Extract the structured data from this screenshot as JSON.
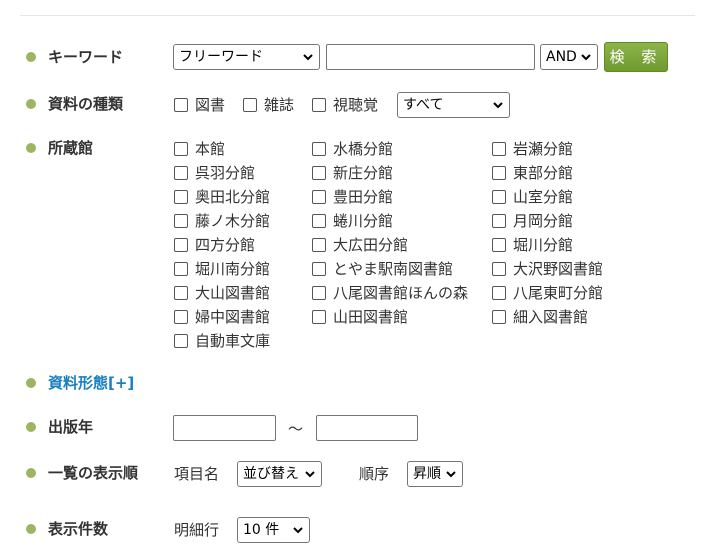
{
  "keyword": {
    "label": "キーワード",
    "field_select": "フリーワード",
    "text_value": "",
    "op_select": "AND",
    "search_button": "検 索"
  },
  "material_type": {
    "label": "資料の種類",
    "options": [
      "図書",
      "雑誌",
      "視聴覚"
    ],
    "select": "すべて"
  },
  "library": {
    "label": "所蔵館",
    "col1": [
      "本館",
      "呉羽分館",
      "奥田北分館",
      "藤ノ木分館",
      "四方分館",
      "堀川南分館",
      "大山図書館",
      "婦中図書館",
      "自動車文庫"
    ],
    "col2": [
      "水橋分館",
      "新庄分館",
      "豊田分館",
      "蜷川分館",
      "大広田分館",
      "とやま駅南図書館",
      "八尾図書館ほんの森",
      "山田図書館"
    ],
    "col3": [
      "岩瀬分館",
      "東部分館",
      "山室分館",
      "月岡分館",
      "堀川分館",
      "大沢野図書館",
      "八尾東町分館",
      "細入図書館"
    ]
  },
  "format": {
    "label": "資料形態[+]"
  },
  "pub_year": {
    "label": "出版年",
    "from": "",
    "tilde": "～",
    "to": ""
  },
  "sort": {
    "label": "一覧の表示順",
    "item_label": "項目名",
    "item_select": "並び替え",
    "order_label": "順序",
    "order_select": "昇順"
  },
  "count": {
    "label": "表示件数",
    "detail_label": "明細行",
    "count_select": "10 件"
  },
  "colors": {
    "bullet": "#9cb561",
    "button": "#7aa63a",
    "link": "#1a7fc1"
  }
}
